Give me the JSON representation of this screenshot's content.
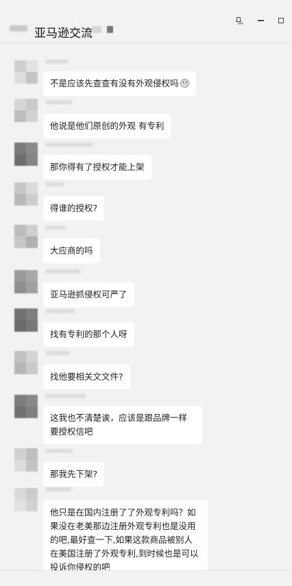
{
  "window": {
    "title": "亚马逊交流",
    "pin_icon": "pin-icon",
    "minimize_icon": "minimize-icon",
    "maximize_icon": "maximize-icon"
  },
  "messages": [
    {
      "text": "不是应该先查查有没有外观侵权吗",
      "emoji": "smile-emoji-icon"
    },
    {
      "text": "他说是他们原创的外观 有专利"
    },
    {
      "text": "那你得有了授权才能上架"
    },
    {
      "text": "得谁的授权?"
    },
    {
      "text": "大应商的吗"
    },
    {
      "text": "亚马逊抓侵权可严了"
    },
    {
      "text": "找有专利的那个人呀"
    },
    {
      "text": "找他要相关文文件?"
    },
    {
      "text": "这我也不清楚诶，应该是跟品牌一样要授权信吧"
    },
    {
      "text": "那我先下架?"
    },
    {
      "text": "他只是在国内注册了了外观专利吗？如果没在老美那边注册外观专利也是没用的吧,最好查一下,如果这款商品被别人在美国注册了外观专利,到时候也是可以投诉你侵权的吧"
    }
  ]
}
